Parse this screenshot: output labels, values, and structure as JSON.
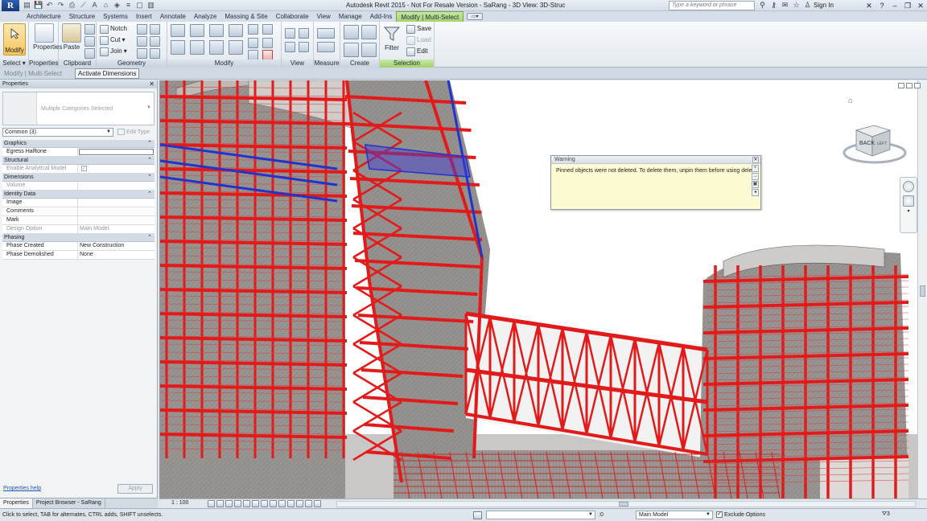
{
  "titlebar": {
    "logo": "R",
    "title": "Autodesk Revit 2015 - Not For Resale Version -   SaRang - 3D View: 3D-Struc",
    "search_placeholder": "Type a keyword or phrase",
    "sign_in": "Sign In",
    "qat_icons": [
      "open-icon",
      "save-icon",
      "undo-icon",
      "redo-icon",
      "print-icon",
      "measure-icon",
      "text-icon",
      "3d-view-icon",
      "section-icon",
      "thin-lines-icon",
      "close-hidden-icon",
      "switch-windows-icon"
    ],
    "qat_glyphs": [
      "▤",
      "💾",
      "↶",
      "↷",
      "⎙",
      "⟋",
      "A",
      "⌂",
      "◈",
      "≡",
      "▢",
      "▥"
    ]
  },
  "tabs": [
    "Architecture",
    "Structure",
    "Systems",
    "Insert",
    "Annotate",
    "Analyze",
    "Massing & Site",
    "Collaborate",
    "View",
    "Manage",
    "Add-Ins",
    "Modify | Multi-Select"
  ],
  "active_tab": "Modify | Multi-Select",
  "ribbon": {
    "select_panel": {
      "modify": "Modify",
      "label": "Select"
    },
    "properties_panel": {
      "button": "Properties",
      "label": "Properties"
    },
    "clipboard_panel": {
      "paste": "Paste",
      "label": "Clipboard"
    },
    "geometry_panel": {
      "notch": "Notch",
      "cut": "Cut",
      "join": "Join",
      "label": "Geometry"
    },
    "modify_panel": {
      "label": "Modify"
    },
    "view_panel": {
      "label": "View"
    },
    "measure_panel": {
      "label": "Measure"
    },
    "create_panel": {
      "label": "Create"
    },
    "selection_panel": {
      "filter": "Filter",
      "save": "Save",
      "load": "Load",
      "edit": "Edit",
      "label": "Selection"
    }
  },
  "optbar": {
    "context": "Modify | Multi-Select",
    "activate_dimensions": "Activate Dimensions"
  },
  "properties": {
    "title": "Properties",
    "type_selector": "Multiple Categories Selected",
    "filter": "Common (3)",
    "edit_type": "Edit Type",
    "groups": [
      {
        "name": "Graphics",
        "rows": [
          {
            "name": "Egress Halftone",
            "value": "",
            "kind": "input"
          }
        ]
      },
      {
        "name": "Structural",
        "rows": [
          {
            "name": "Enable Analytical Model",
            "value": "✓",
            "kind": "check-dim"
          }
        ]
      },
      {
        "name": "Dimensions",
        "rows": [
          {
            "name": "Volume",
            "value": "",
            "kind": "dim"
          }
        ]
      },
      {
        "name": "Identity Data",
        "rows": [
          {
            "name": "Image",
            "value": "",
            "kind": "text"
          },
          {
            "name": "Comments",
            "value": "",
            "kind": "text"
          },
          {
            "name": "Mark",
            "value": "",
            "kind": "text"
          },
          {
            "name": "Design Option",
            "value": "Main Model",
            "kind": "dim"
          }
        ]
      },
      {
        "name": "Phasing",
        "rows": [
          {
            "name": "Phase Created",
            "value": "New Construction",
            "kind": "text"
          },
          {
            "name": "Phase Demolished",
            "value": "None",
            "kind": "text"
          }
        ]
      }
    ],
    "help_link": "Properties help",
    "apply": "Apply"
  },
  "palette_tabs": [
    "Properties",
    "Project Browser - SaRang"
  ],
  "warning": {
    "title": "Warning",
    "message": "Pinned objects were not deleted. To delete them, unpin them before using delete."
  },
  "viewcube": {
    "face": "BACK",
    "side": "LEFT"
  },
  "viewbar": {
    "scale": "1 : 100"
  },
  "statusbar": {
    "hint": "Click to select, TAB for alternates, CTRL adds, SHIFT unselects.",
    "zero": ":0",
    "design_option": "Main Model",
    "exclude_options": "Exclude Options",
    "filter_count": "3"
  },
  "colors": {
    "steel_red": "#e21a1a",
    "selected_blue": "#2233cc",
    "slab_gray": "#8f8a88",
    "active_tab_green": "#a6d36f"
  }
}
